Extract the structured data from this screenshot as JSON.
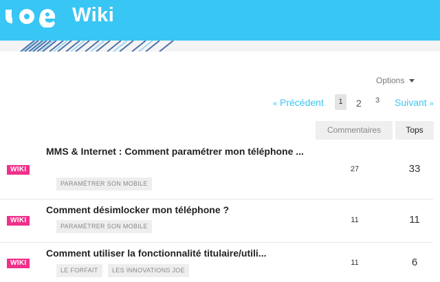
{
  "header": {
    "logo_text": "joe",
    "title": "Wiki",
    "background": "#38c6f4"
  },
  "options": {
    "label": "Options"
  },
  "pagination": {
    "prev": "Précédent",
    "prev_arrow": "«",
    "pages": [
      "1",
      "2",
      "3"
    ],
    "current": "1",
    "next": "Suivant",
    "next_arrow": "»"
  },
  "columns": {
    "comments": "Commentaires",
    "tops": "Tops"
  },
  "topics": [
    {
      "badge": "WIKI",
      "title": "MMS & Internet : Comment paramétrer mon téléphone ...",
      "tags": [
        "PARAMÉTRER SON MOBILE"
      ],
      "comments": "27",
      "tops": "33"
    },
    {
      "badge": "WIKI",
      "title": "Comment désimlocker mon téléphone ?",
      "tags": [
        "PARAMÉTRER SON MOBILE"
      ],
      "comments": "11",
      "tops": "11"
    },
    {
      "badge": "WIKI",
      "title": "Comment utiliser la fonctionnalité titulaire/utili...",
      "tags": [
        "LE FORFAIT",
        "LES INNOVATIONS JOE"
      ],
      "comments": "11",
      "tops": "6"
    }
  ],
  "colors": {
    "accent": "#38c6f4",
    "badge": "#f0308a"
  }
}
